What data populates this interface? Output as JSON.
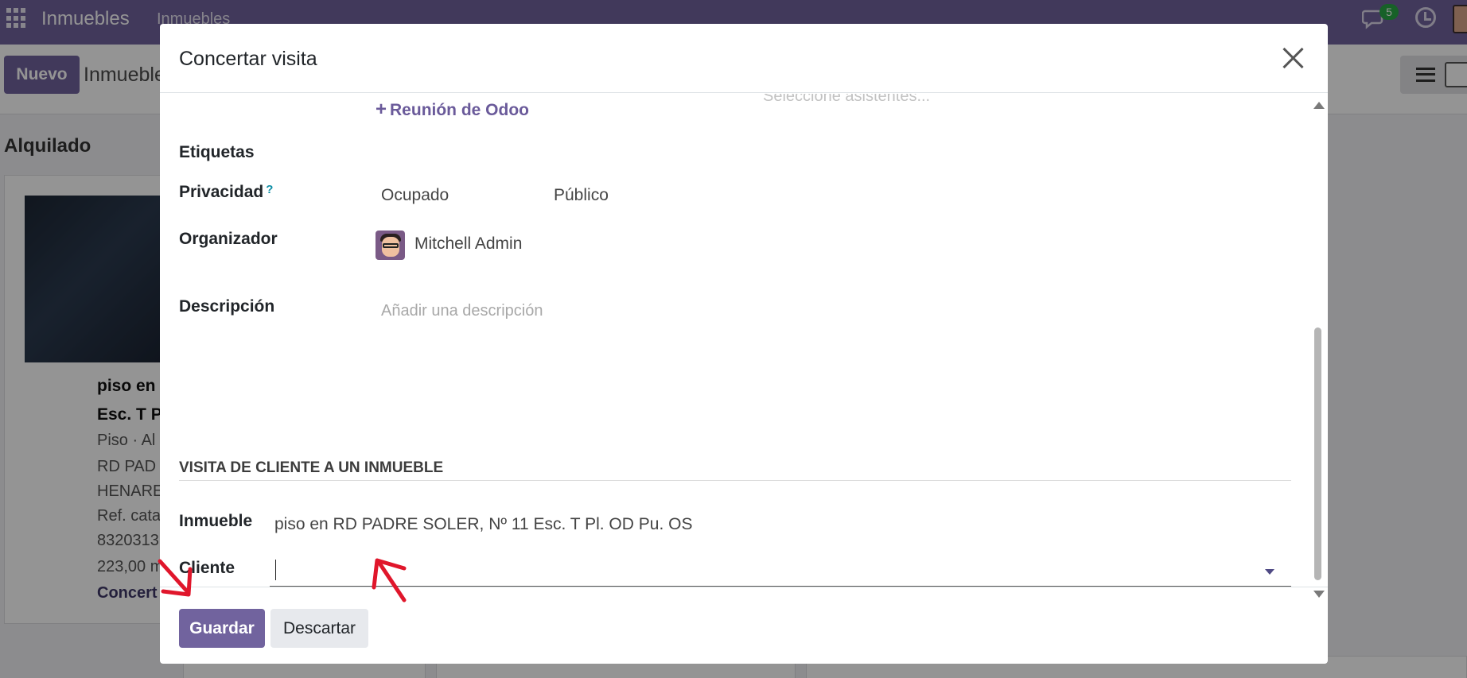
{
  "app": {
    "brand": "Inmuebles",
    "menu": [
      "Inmuebles"
    ],
    "notifications_count": "5"
  },
  "control_panel": {
    "new_button": "Nuevo",
    "breadcrumb": "Inmuebles"
  },
  "kanban": {
    "column_title": "Alquilado",
    "card": {
      "title_line1": "piso en",
      "title_line2": "Esc. T P",
      "lines": [
        "Piso · Al",
        "RD PAD",
        "HENARE",
        "Ref. cata",
        "8320313",
        "223,00 m"
      ],
      "action": "Concert"
    }
  },
  "modal": {
    "title": "Concertar visita",
    "close_icon": "close-icon",
    "attendees_placeholder": "Seleccione asistentes...",
    "add_meeting_label": "Reunión de Odoo",
    "fields": {
      "tags_label": "Etiquetas",
      "privacy_label": "Privacidad",
      "privacy_help": "?",
      "privacy_show_as": "Ocupado",
      "privacy_value": "Público",
      "organizer_label": "Organizador",
      "organizer_value": "Mitchell Admin",
      "description_label": "Descripción",
      "description_placeholder": "Añadir una descripción"
    },
    "section": {
      "title": "VISITA DE CLIENTE A UN INMUEBLE",
      "property_label": "Inmueble",
      "property_value": "piso en RD PADRE SOLER, Nº 11 Esc. T Pl. OD Pu. OS",
      "client_label": "Cliente",
      "client_value": ""
    },
    "footer": {
      "save_button": "Guardar",
      "discard_button": "Descartar"
    }
  },
  "colors": {
    "brand": "#71639e",
    "annotation_arrow": "#e0162b",
    "badge": "#28a745"
  }
}
